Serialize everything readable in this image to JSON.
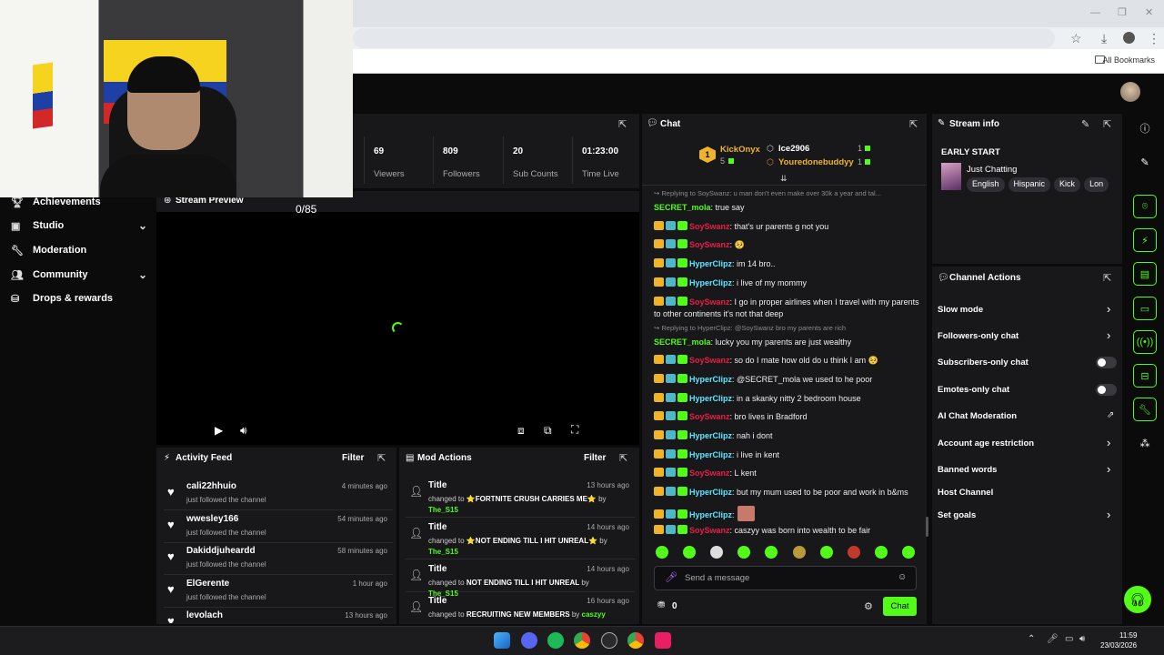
{
  "browser": {
    "bookmarks_label": "All Bookmarks"
  },
  "sidebar": {
    "items": [
      {
        "label": "Achievements",
        "icon": "trophy-icon"
      },
      {
        "label": "Studio",
        "icon": "studio-icon",
        "expandable": true
      },
      {
        "label": "Moderation",
        "icon": "wrench-icon"
      },
      {
        "label": "Community",
        "icon": "community-icon",
        "expandable": true
      },
      {
        "label": "Drops & rewards",
        "icon": "drops-icon"
      }
    ]
  },
  "stats": [
    {
      "value": "69",
      "label": "Viewers"
    },
    {
      "value": "809",
      "label": "Followers"
    },
    {
      "value": "20",
      "label": "Sub Counts"
    },
    {
      "value": "01:23:00",
      "label": "Time Live"
    }
  ],
  "preview": {
    "title": "Stream Preview",
    "counter": "0/85"
  },
  "activity": {
    "title": "Activity Feed",
    "filter": "Filter",
    "items": [
      {
        "name": "cali22hhuio",
        "sub": "just followed the channel",
        "time": "4 minutes ago"
      },
      {
        "name": "wwesley166",
        "sub": "just followed the channel",
        "time": "54 minutes ago"
      },
      {
        "name": "Dakiddjuheardd",
        "sub": "just followed the channel",
        "time": "58 minutes ago"
      },
      {
        "name": "ElGerente",
        "sub": "just followed the channel",
        "time": "1 hour ago"
      },
      {
        "name": "levolach",
        "sub": "",
        "time": "13 hours ago"
      }
    ]
  },
  "mod_actions": {
    "title": "Mod Actions",
    "filter": "Filter",
    "items": [
      {
        "title": "Title",
        "time": "13 hours ago",
        "pre": "changed to",
        "value": "⭐FORTNITE CRUSH CARRIES ME⭐",
        "by": "by",
        "user": "The_S15"
      },
      {
        "title": "Title",
        "time": "14 hours ago",
        "pre": "changed to",
        "value": "⭐NOT ENDING TILL I HIT UNREAL⭐",
        "by": "by",
        "user": "The_S15"
      },
      {
        "title": "Title",
        "time": "14 hours ago",
        "pre": "changed to",
        "value": "NOT ENDING TILL I HIT UNREAL",
        "by": "by",
        "user": "The_S15"
      },
      {
        "title": "Title",
        "time": "16 hours ago",
        "pre": "changed to",
        "value": "RECRUITING NEW MEMBERS",
        "by": "by",
        "user": "caszyy"
      }
    ]
  },
  "chat": {
    "title": "Chat",
    "leaderboard": {
      "rank": "1",
      "top": {
        "name": "KickOnyx",
        "count": "5"
      },
      "list": [
        {
          "name": "Ice2906",
          "count": "1"
        },
        {
          "name": "Youredonebuddyy",
          "count": "1"
        }
      ]
    },
    "messages": [
      {
        "reply": "Replying to SoySwanz: u man don't even make over 30k a year and tal..."
      },
      {
        "user": "SECRET_mola",
        "color": "#53fc18",
        "text": ": true say"
      },
      {
        "user": "SoySwanz",
        "color": "#e91e46",
        "text": ": that's ur parents g not you",
        "badges": true
      },
      {
        "user": "SoySwanz",
        "color": "#e91e46",
        "text": ": 🥺",
        "badges": true
      },
      {
        "user": "HyperClipz",
        "color": "#5ee7ff",
        "text": ": im 14 bro..",
        "badges": true
      },
      {
        "user": "HyperClipz",
        "color": "#5ee7ff",
        "text": ": i live of my mommy",
        "badges": true
      },
      {
        "user": "SoySwanz",
        "color": "#e91e46",
        "text": ": I go in proper airlines when I travel with my parents to other continents it's not that deep",
        "badges": true
      },
      {
        "reply": "Replying to HyperClipz: @SoySwanz bro my parents are rich"
      },
      {
        "user": "SECRET_mola",
        "color": "#53fc18",
        "text": ": lucky you my parents are just wealthy"
      },
      {
        "user": "SoySwanz",
        "color": "#e91e46",
        "text": ": so do I mate how old do u think I am 🥺",
        "badges": true
      },
      {
        "user": "HyperClipz",
        "color": "#5ee7ff",
        "text": ": @SECRET_mola we used to he poor",
        "badges": true
      },
      {
        "user": "HyperClipz",
        "color": "#5ee7ff",
        "text": ": in a skanky nitty 2 bedroom house",
        "badges": true
      },
      {
        "user": "SoySwanz",
        "color": "#e91e46",
        "text": ": bro lives in Bradford",
        "badges": true
      },
      {
        "user": "HyperClipz",
        "color": "#5ee7ff",
        "text": ": nah i dont",
        "badges": true
      },
      {
        "user": "HyperClipz",
        "color": "#5ee7ff",
        "text": ": i live in kent",
        "badges": true
      },
      {
        "user": "SoySwanz",
        "color": "#e91e46",
        "text": ": L kent",
        "badges": true
      },
      {
        "user": "HyperClipz",
        "color": "#5ee7ff",
        "text": ": but my mum used to be poor and work in b&ms",
        "badges": true
      },
      {
        "user": "HyperClipz",
        "color": "#5ee7ff",
        "text": ":",
        "badges": true,
        "emote": true
      },
      {
        "user": "SoySwanz",
        "color": "#e91e46",
        "text": ": caszyy was born into wealth to be fair",
        "badges": true
      }
    ],
    "input_placeholder": "Send a message",
    "points": "0",
    "send_label": "Chat"
  },
  "stream_info": {
    "title": "Stream info",
    "stream_title": "EARLY START",
    "category": "Just Chatting",
    "tags": [
      "English",
      "Hispanic",
      "Kick",
      "Lon"
    ]
  },
  "channel_actions": {
    "title": "Channel Actions",
    "items": [
      {
        "label": "Slow mode",
        "control": "chevron"
      },
      {
        "label": "Followers-only chat",
        "control": "chevron"
      },
      {
        "label": "Subscribers-only chat",
        "control": "toggle"
      },
      {
        "label": "Emotes-only chat",
        "control": "toggle"
      },
      {
        "label": "AI Chat Moderation",
        "control": "external"
      },
      {
        "label": "Account age restriction",
        "control": "chevron"
      },
      {
        "label": "Banned words",
        "control": "chevron"
      },
      {
        "label": "Host Channel",
        "control": "none"
      },
      {
        "label": "Set goals",
        "control": "chevron"
      }
    ]
  },
  "taskbar": {
    "time": "11:59",
    "date": "23/03/2026"
  },
  "colors": {
    "accent": "#53fc18",
    "panel": "#18181b",
    "background": "#0b0b0c"
  }
}
